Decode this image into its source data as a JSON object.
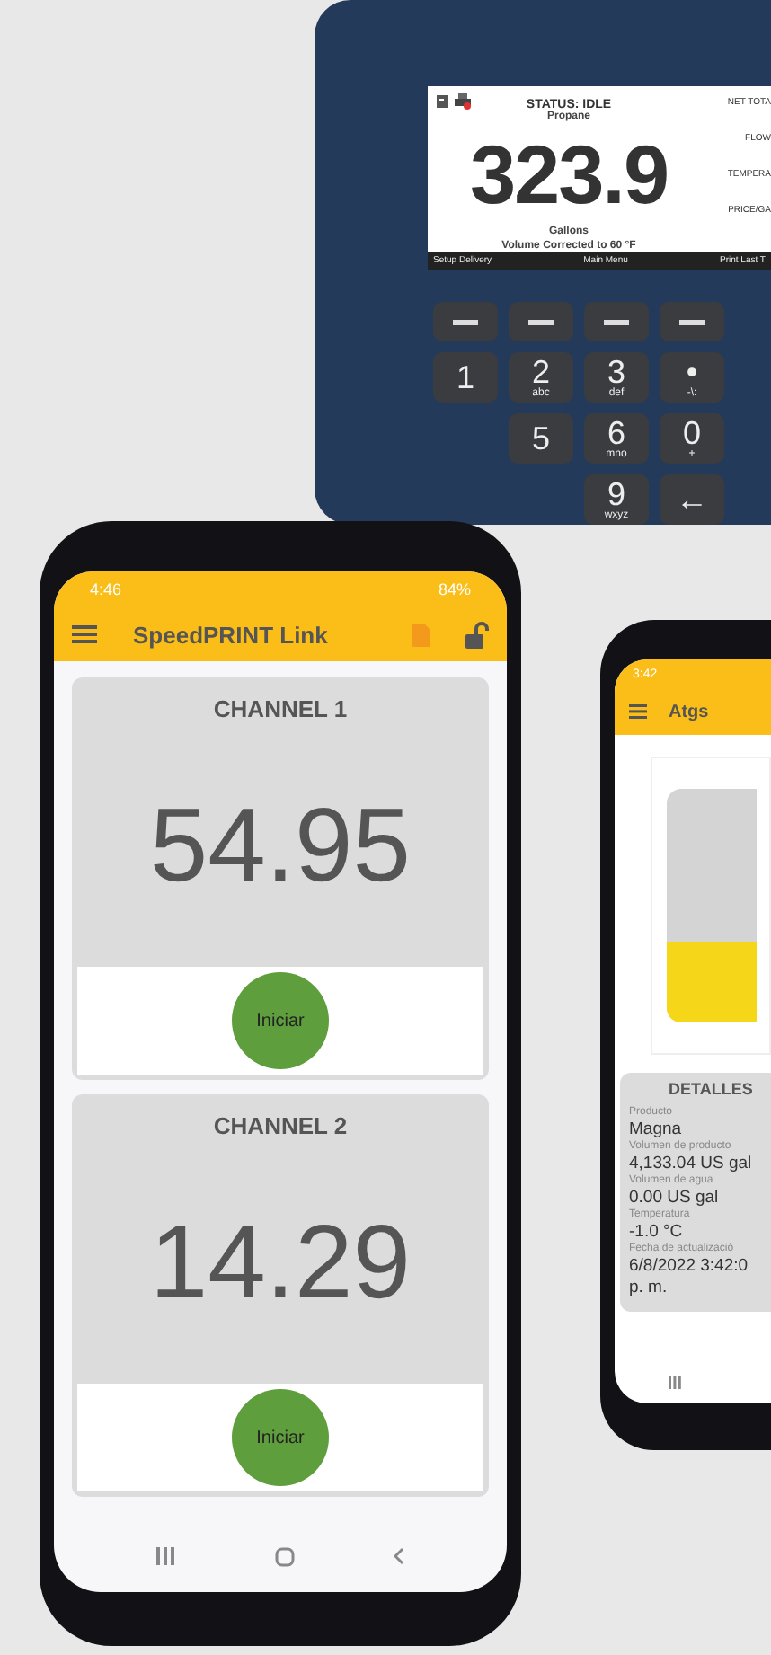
{
  "terminal": {
    "status": "STATUS: IDLE",
    "product": "Propane",
    "reading": "323.9",
    "unit": "Gallons",
    "note": "Volume Corrected to 60 °F",
    "side_labels": [
      "NET TOTA",
      "FLOW",
      "TEMPERA",
      "PRICE/GA"
    ],
    "softkeys": [
      "Setup Delivery",
      "Main Menu",
      "Print Last T"
    ],
    "keys": [
      {
        "digit": "1"
      },
      {
        "digit": "2",
        "letters": "abc"
      },
      {
        "digit": "3",
        "letters": "def"
      },
      {
        "digit": "•",
        "letters": "-\\:"
      },
      {
        "digit": "5"
      },
      {
        "digit": "6",
        "letters": "mno"
      },
      {
        "digit": "0",
        "letters": "+"
      },
      {
        "digit": "9",
        "letters": "wxyz"
      },
      {
        "digit": "←"
      }
    ]
  },
  "phone_main": {
    "status_bar": {
      "time": "4:46",
      "battery": "84%"
    },
    "app_bar": {
      "title": "SpeedPRINT Link"
    },
    "channels": [
      {
        "name": "CHANNEL 1",
        "value": "54.95",
        "button": "Iniciar"
      },
      {
        "name": "CHANNEL 2",
        "value": "14.29",
        "button": "Iniciar"
      }
    ]
  },
  "phone_atgs": {
    "status_bar": {
      "time": "3:42"
    },
    "app_bar": {
      "title": "Atgs"
    },
    "tank": {
      "level": 0.35
    },
    "details": {
      "title": "DETALLES",
      "fields": [
        {
          "label": "Producto",
          "value": "Magna"
        },
        {
          "label": "Volumen de producto",
          "value": "4,133.04 US gal"
        },
        {
          "label": "Volumen de agua",
          "value": "0.00 US gal"
        },
        {
          "label": "Temperatura",
          "value": "-1.0 °C"
        },
        {
          "label": "Fecha de actualizació",
          "value": "6/8/2022 3:42:0",
          "value_continued": "p. m."
        }
      ]
    }
  }
}
